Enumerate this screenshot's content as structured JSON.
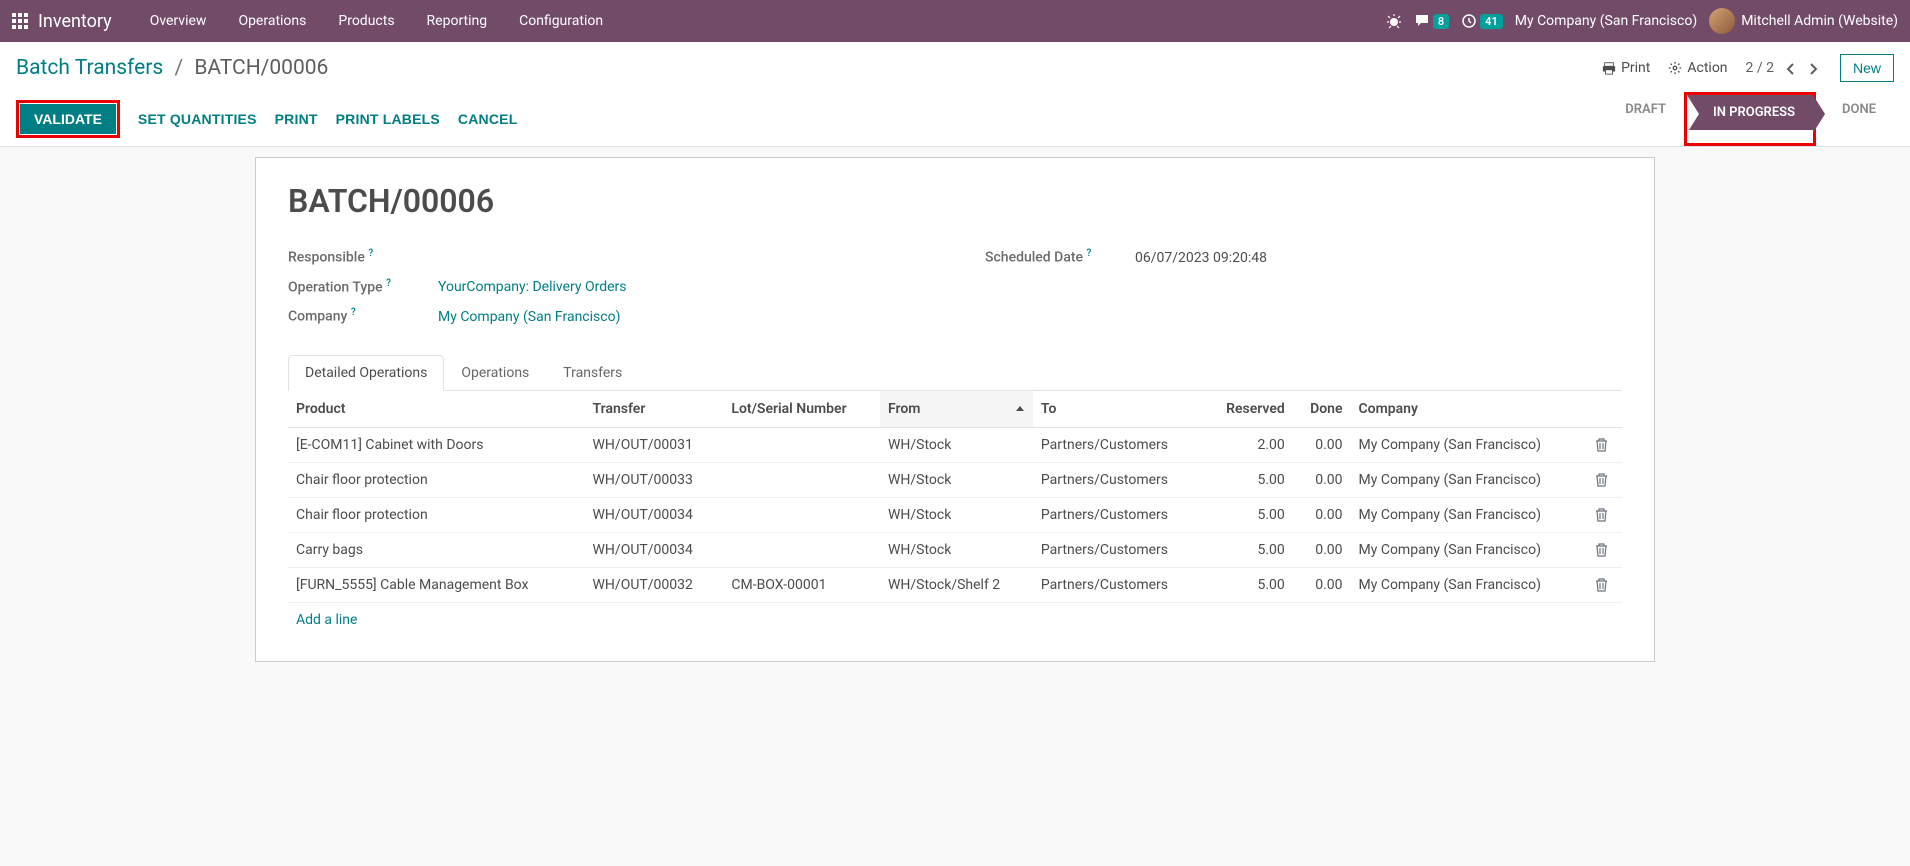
{
  "nav": {
    "brand": "Inventory",
    "items": [
      "Overview",
      "Operations",
      "Products",
      "Reporting",
      "Configuration"
    ],
    "company": "My Company (San Francisco)",
    "user": "Mitchell Admin (Website)",
    "msg_count": "8",
    "activity_count": "41"
  },
  "breadcrumb": {
    "parent": "Batch Transfers",
    "current": "BATCH/00006"
  },
  "cp": {
    "print": "Print",
    "action": "Action",
    "pager": "2 / 2",
    "new": "New"
  },
  "buttons": {
    "validate": "VALIDATE",
    "set_qty": "SET QUANTITIES",
    "print": "PRINT",
    "print_labels": "PRINT LABELS",
    "cancel": "CANCEL"
  },
  "status": {
    "draft": "DRAFT",
    "in_progress": "IN PROGRESS",
    "done": "DONE"
  },
  "record": {
    "name": "BATCH/00006",
    "labels": {
      "responsible": "Responsible",
      "operation_type": "Operation Type",
      "company": "Company",
      "scheduled_date": "Scheduled Date"
    },
    "responsible": "",
    "operation_type": "YourCompany: Delivery Orders",
    "company": "My Company (San Francisco)",
    "scheduled_date": "06/07/2023 09:20:48"
  },
  "tabs": {
    "detailed": "Detailed Operations",
    "operations": "Operations",
    "transfers": "Transfers"
  },
  "table": {
    "headers": {
      "product": "Product",
      "transfer": "Transfer",
      "lot": "Lot/Serial Number",
      "from": "From",
      "to": "To",
      "reserved": "Reserved",
      "done": "Done",
      "company": "Company"
    },
    "rows": [
      {
        "product": "[E-COM11] Cabinet with Doors",
        "transfer": "WH/OUT/00031",
        "lot": "",
        "from": "WH/Stock",
        "to": "Partners/Customers",
        "reserved": "2.00",
        "done": "0.00",
        "company": "My Company (San Francisco)"
      },
      {
        "product": "Chair floor protection",
        "transfer": "WH/OUT/00033",
        "lot": "",
        "from": "WH/Stock",
        "to": "Partners/Customers",
        "reserved": "5.00",
        "done": "0.00",
        "company": "My Company (San Francisco)"
      },
      {
        "product": "Chair floor protection",
        "transfer": "WH/OUT/00034",
        "lot": "",
        "from": "WH/Stock",
        "to": "Partners/Customers",
        "reserved": "5.00",
        "done": "0.00",
        "company": "My Company (San Francisco)"
      },
      {
        "product": "Carry bags",
        "transfer": "WH/OUT/00034",
        "lot": "",
        "from": "WH/Stock",
        "to": "Partners/Customers",
        "reserved": "5.00",
        "done": "0.00",
        "company": "My Company (San Francisco)"
      },
      {
        "product": "[FURN_5555] Cable Management Box",
        "transfer": "WH/OUT/00032",
        "lot": "CM-BOX-00001",
        "from": "WH/Stock/Shelf 2",
        "to": "Partners/Customers",
        "reserved": "5.00",
        "done": "0.00",
        "company": "My Company (San Francisco)"
      }
    ],
    "add_line": "Add a line"
  }
}
